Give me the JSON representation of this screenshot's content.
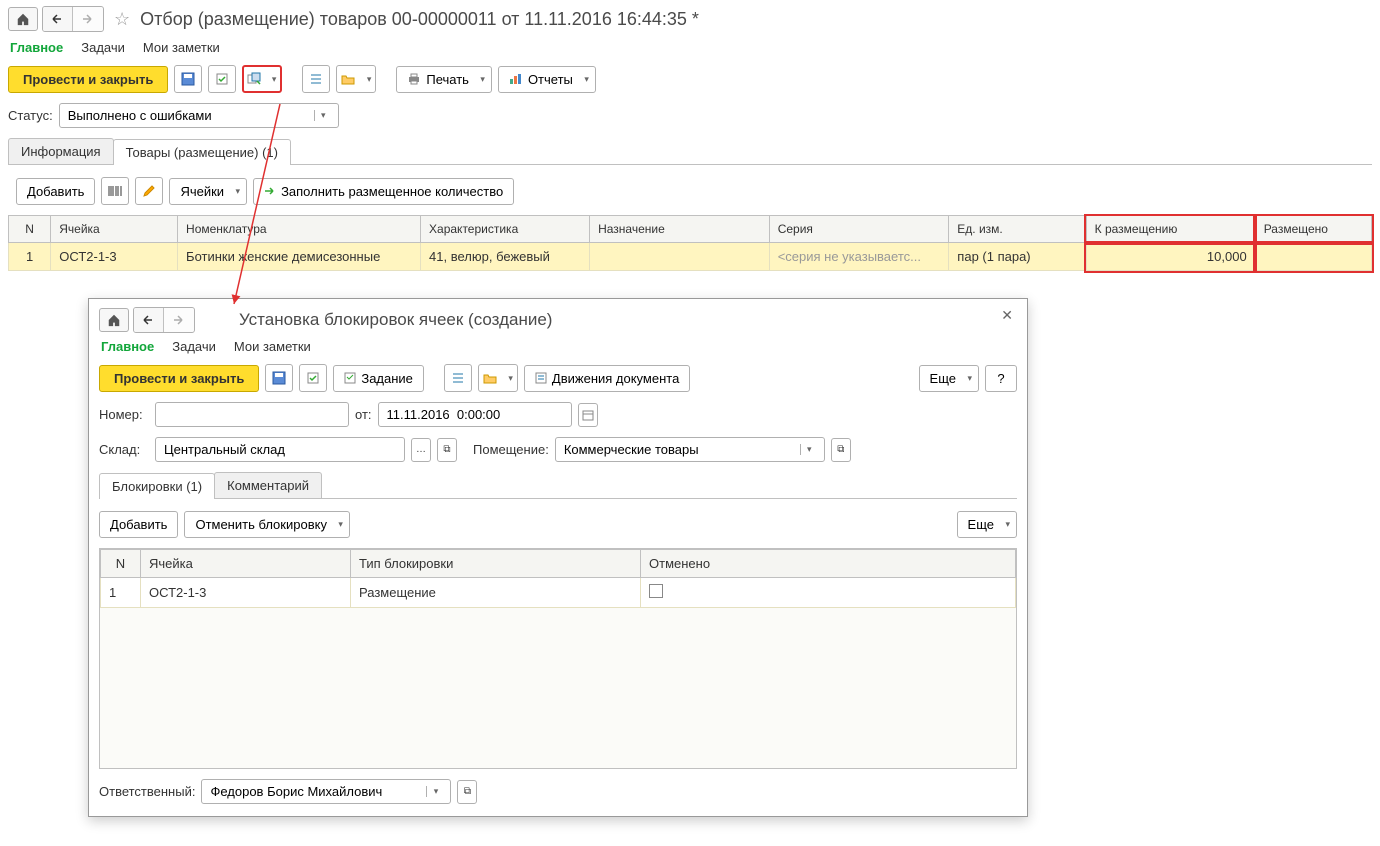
{
  "main": {
    "title": "Отбор (размещение) товаров 00-00000011 от 11.11.2016 16:44:35 *",
    "nav": {
      "main": "Главное",
      "tasks": "Задачи",
      "notes": "Мои заметки"
    },
    "toolbar": {
      "submit": "Провести и закрыть",
      "print": "Печать",
      "reports": "Отчеты"
    },
    "status_label": "Статус:",
    "status_value": "Выполнено с ошибками",
    "tabs": {
      "info": "Информация",
      "goods": "Товары (размещение) (1)"
    },
    "sub": {
      "add": "Добавить",
      "cells": "Ячейки",
      "fill": "Заполнить размещенное количество"
    },
    "grid": {
      "headers": {
        "n": "N",
        "cell": "Ячейка",
        "nomen": "Номенклатура",
        "char": "Характеристика",
        "purpose": "Назначение",
        "series": "Серия",
        "unit": "Ед. изм.",
        "toplace": "К размещению",
        "placed": "Размещено"
      },
      "row": {
        "n": "1",
        "cell": "ОСТ2-1-3",
        "nomen": "Ботинки женские демисезонные",
        "char": "41, велюр, бежевый",
        "purpose": "",
        "series": "<серия не указываетс...",
        "unit": "пар (1 пара)",
        "toplace": "10,000",
        "placed": ""
      }
    }
  },
  "popup": {
    "title": "Установка блокировок ячеек (создание)",
    "nav": {
      "main": "Главное",
      "tasks": "Задачи",
      "notes": "Мои заметки"
    },
    "toolbar": {
      "submit": "Провести и закрыть",
      "task": "Задание",
      "movements": "Движения документа",
      "more": "Еще",
      "help": "?"
    },
    "number_label": "Номер:",
    "from_label": "от:",
    "date": "11.11.2016  0:00:00",
    "warehouse_label": "Склад:",
    "warehouse": "Центральный склад",
    "room_label": "Помещение:",
    "room": "Коммерческие товары",
    "tabs": {
      "blocks": "Блокировки (1)",
      "comment": "Комментарий"
    },
    "sub": {
      "add": "Добавить",
      "cancel": "Отменить блокировку",
      "more": "Еще"
    },
    "grid": {
      "headers": {
        "n": "N",
        "cell": "Ячейка",
        "type": "Тип блокировки",
        "cancelled": "Отменено"
      },
      "row": {
        "n": "1",
        "cell": "ОСТ2-1-3",
        "type": "Размещение"
      }
    },
    "resp_label": "Ответственный:",
    "resp": "Федоров Борис Михайлович"
  }
}
